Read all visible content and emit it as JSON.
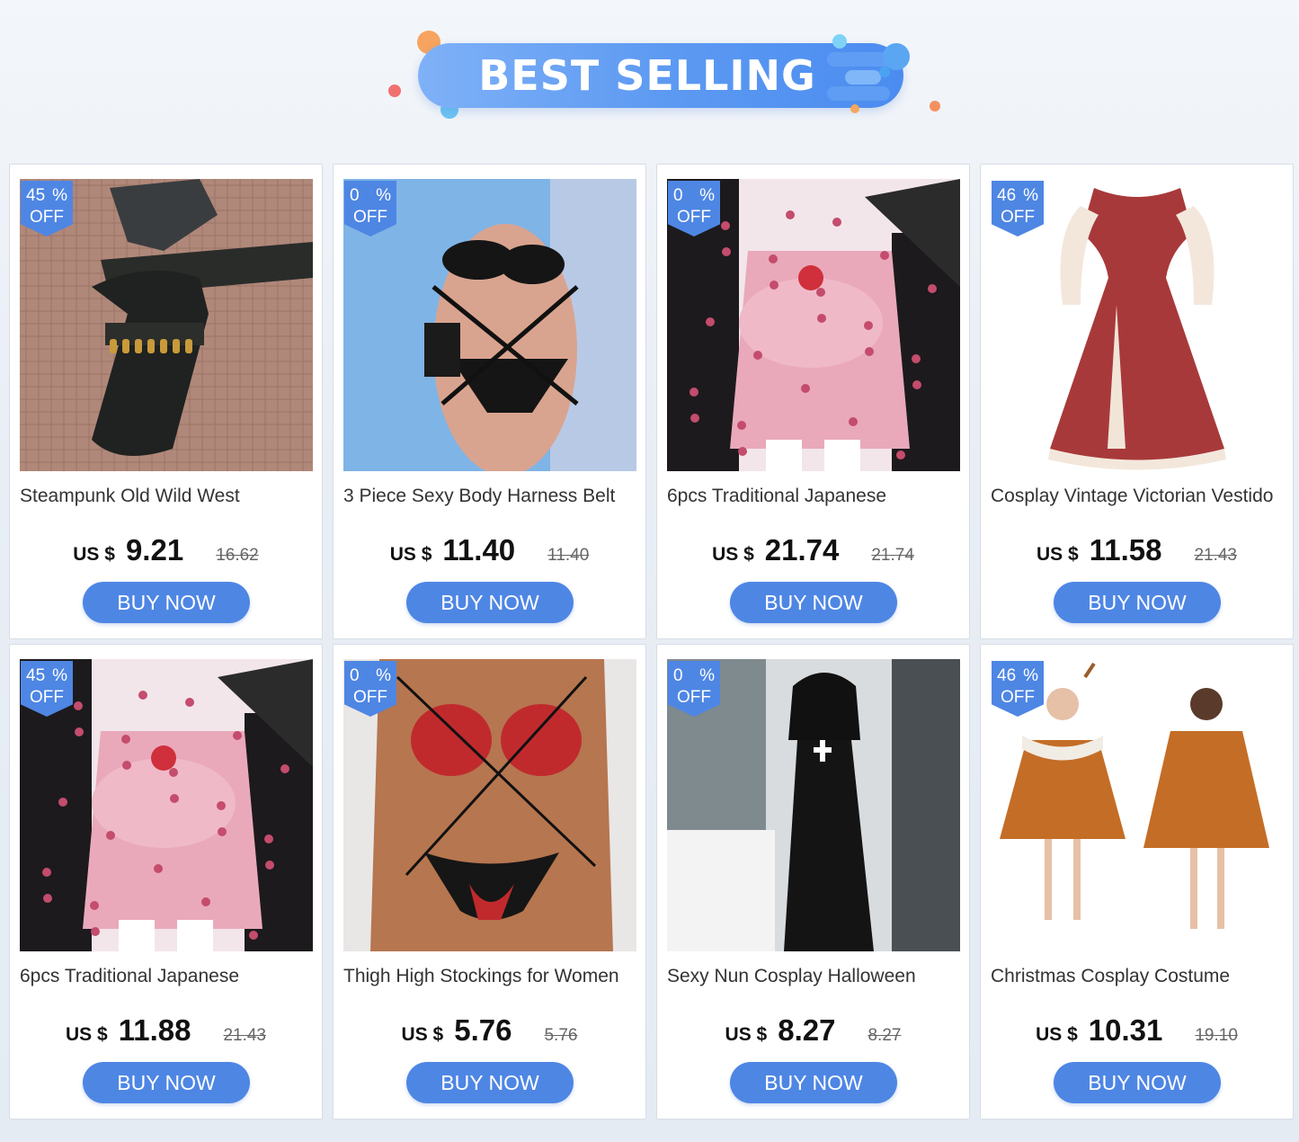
{
  "banner": {
    "title": "BEST SELLING",
    "colors": {
      "pill": "#5d9af2",
      "accent_orange": "#f5a25d",
      "accent_cyan": "#6fd0f5"
    }
  },
  "theme": {
    "button_color": "#4e86e4",
    "badge_color": "#4e86e4"
  },
  "products": [
    {
      "image_icon": "gun-holster-photo",
      "discount": "45",
      "percent_sign": "%",
      "off_label": "OFF",
      "title": "Steampunk Old Wild West",
      "currency": "US $",
      "price": "9.21",
      "original_price": "16.62",
      "button": "BUY NOW"
    },
    {
      "image_icon": "body-harness-photo",
      "discount": "0",
      "percent_sign": "%",
      "off_label": "OFF",
      "title": "3 Piece Sexy Body Harness Belt",
      "currency": "US $",
      "price": "11.40",
      "original_price": "11.40",
      "button": "BUY NOW"
    },
    {
      "image_icon": "kimono-costume-photo",
      "discount": "0",
      "percent_sign": "%",
      "off_label": "OFF",
      "title": "6pcs Traditional Japanese",
      "currency": "US $",
      "price": "21.74",
      "original_price": "21.74",
      "button": "BUY NOW"
    },
    {
      "image_icon": "victorian-dress-photo",
      "discount": "46",
      "percent_sign": "%",
      "off_label": "OFF",
      "title": "Cosplay Vintage Victorian Vestido",
      "currency": "US $",
      "price": "11.58",
      "original_price": "21.43",
      "button": "BUY NOW"
    },
    {
      "image_icon": "kimono-costume-photo",
      "discount": "45",
      "percent_sign": "%",
      "off_label": "OFF",
      "title": "6pcs Traditional Japanese",
      "currency": "US $",
      "price": "11.88",
      "original_price": "21.43",
      "button": "BUY NOW"
    },
    {
      "image_icon": "lingerie-set-photo",
      "discount": "0",
      "percent_sign": "%",
      "off_label": "OFF",
      "title": "Thigh High Stockings for Women",
      "currency": "US $",
      "price": "5.76",
      "original_price": "5.76",
      "button": "BUY NOW"
    },
    {
      "image_icon": "nun-costume-photo",
      "discount": "0",
      "percent_sign": "%",
      "off_label": "OFF",
      "title": "Sexy Nun Cosplay Halloween",
      "currency": "US $",
      "price": "8.27",
      "original_price": "8.27",
      "button": "BUY NOW"
    },
    {
      "image_icon": "reindeer-costume-photo",
      "discount": "46",
      "percent_sign": "%",
      "off_label": "OFF",
      "title": "Christmas Cosplay Costume",
      "currency": "US $",
      "price": "10.31",
      "original_price": "19.10",
      "button": "BUY NOW"
    }
  ]
}
